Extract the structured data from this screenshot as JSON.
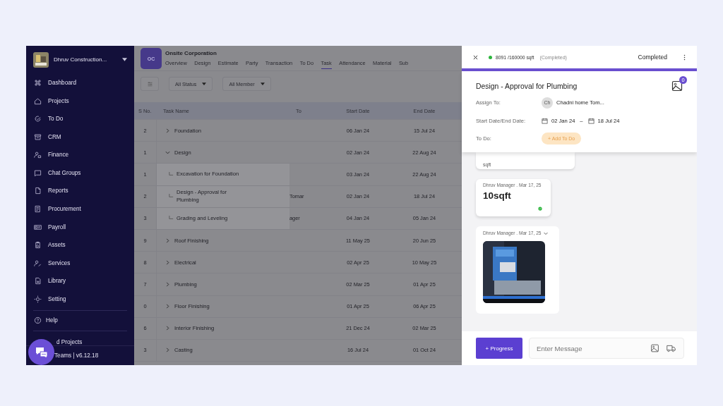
{
  "sidebar": {
    "company": "Dhruv Construction...",
    "items": [
      {
        "label": "Dashboard"
      },
      {
        "label": "Projects"
      },
      {
        "label": "To Do"
      },
      {
        "label": "CRM"
      },
      {
        "label": "Finance"
      },
      {
        "label": "Chat Groups"
      },
      {
        "label": "Reports"
      },
      {
        "label": "Procurement"
      },
      {
        "label": "Payroll"
      },
      {
        "label": "Assets"
      },
      {
        "label": "Services"
      },
      {
        "label": "Library"
      },
      {
        "label": "Setting"
      }
    ],
    "help": "Help",
    "partial_item": "d Projects",
    "footer": "Teams | v6.12.18"
  },
  "project": {
    "logo": "OC",
    "name": "Onsite Corporation",
    "tabs": [
      {
        "label": "Overview",
        "selected": false
      },
      {
        "label": "Design",
        "selected": false
      },
      {
        "label": "Estimate",
        "selected": false
      },
      {
        "label": "Party",
        "selected": false
      },
      {
        "label": "Transaction",
        "selected": false
      },
      {
        "label": "To Do",
        "selected": false
      },
      {
        "label": "Task",
        "selected": true
      },
      {
        "label": "Attendance",
        "selected": false
      },
      {
        "label": "Material",
        "selected": false
      },
      {
        "label": "Sub",
        "selected": false
      }
    ]
  },
  "filters": [
    {
      "label": "All Status"
    },
    {
      "label": "All Member"
    }
  ],
  "table": {
    "columns": [
      "S No.",
      "Task Name",
      "To",
      "Start Date",
      "End Date"
    ],
    "rows": [
      {
        "sno": "2",
        "name": "Foundation",
        "start": "06 Jan 24",
        "end": "15 Jul 24",
        "expanded": false
      },
      {
        "sno": "1",
        "name": "Design",
        "start": "02 Jan 24",
        "end": "22 Aug 24",
        "expanded": true,
        "children": [
          {
            "sno": "1",
            "name": "Excavation for Foundation",
            "start": "03 Jan 24",
            "end": "22 Aug 24"
          },
          {
            "sno": "2",
            "name": "Design - Approval for Plumbing",
            "to": "Tomar",
            "start": "02 Jan 24",
            "end": "18 Jul 24"
          },
          {
            "sno": "3",
            "name": "Grading and Leveling",
            "to": "ager",
            "start": "04 Jan 24",
            "end": "05 Jan 24"
          }
        ]
      },
      {
        "sno": "9",
        "name": "Roof Finishing",
        "start": "11 May 25",
        "end": "20 Jun 25",
        "expanded": false
      },
      {
        "sno": "8",
        "name": "Electrical",
        "start": "02 Apr 25",
        "end": "10 May 25",
        "expanded": false
      },
      {
        "sno": "7",
        "name": "Plumbing",
        "start": "02 Mar 25",
        "end": "01 Apr 25",
        "expanded": false
      },
      {
        "sno": "0",
        "name": "Floor Finishing",
        "start": "01 Apr 25",
        "end": "06 Apr 25",
        "expanded": false
      },
      {
        "sno": "6",
        "name": "Interior Finishing",
        "start": "21 Dec 24",
        "end": "02 Mar 25",
        "expanded": false
      },
      {
        "sno": "3",
        "name": "Casting",
        "start": "16 Jul 24",
        "end": "01 Oct 24",
        "expanded": false
      }
    ]
  },
  "drawer": {
    "progress": "8091 /160000 sqft",
    "progress_status": "(Completed)",
    "status": "Completed",
    "title": "Design - Approval for Plumbing",
    "image_count": "0",
    "fields": [
      {
        "kind": "assignee",
        "label": "Assign To:",
        "avatar": "Ch",
        "value": "Chadni home Tom..."
      },
      {
        "kind": "dates",
        "label": "Start Date/End Date:",
        "start": "02 Jan 24",
        "separator": "–",
        "end": "18 Jul 24"
      },
      {
        "kind": "action",
        "label": "To Do:",
        "button": "+ Add To Do"
      }
    ],
    "feed": [
      {
        "kind": "partial",
        "text": "sqft"
      },
      {
        "kind": "value",
        "meta": "Dhruv Manager . Mar 17, 25",
        "value": "10sqft",
        "verified": true
      },
      {
        "meta": "Dhruv Manager . Mar 17, 25"
      }
    ],
    "progress_button": "+ Progress",
    "message": {
      "placeholder": "Enter Message"
    }
  }
}
